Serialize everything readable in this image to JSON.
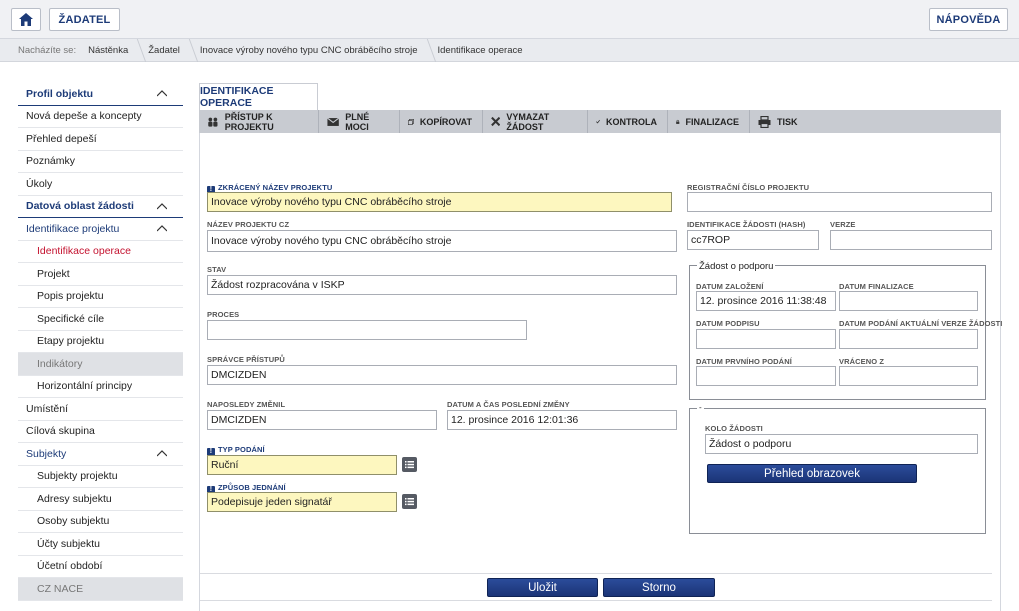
{
  "topbar": {
    "home_icon": "home-icon",
    "applicant_label": "ŽADATEL",
    "help_label": "NÁPOVĚDA"
  },
  "breadcrumb": {
    "lead": "Nacházíte se:",
    "items": [
      "Nástěnka",
      "Žadatel",
      "Inovace výroby nového typu CNC obráběcího stroje",
      "Identifikace operace"
    ]
  },
  "sidebar": {
    "items": [
      {
        "label": "Profil objektu"
      },
      {
        "label": "Nová depeše a koncepty"
      },
      {
        "label": "Přehled depeší"
      },
      {
        "label": "Poznámky"
      },
      {
        "label": "Úkoly"
      },
      {
        "label": "Datová oblast žádosti"
      },
      {
        "label": "Identifikace projektu"
      },
      {
        "label": "Identifikace operace"
      },
      {
        "label": "Projekt"
      },
      {
        "label": "Popis projektu"
      },
      {
        "label": "Specifické cíle"
      },
      {
        "label": "Etapy projektu"
      },
      {
        "label": "Indikátory"
      },
      {
        "label": "Horizontální principy"
      },
      {
        "label": "Umístění"
      },
      {
        "label": "Cílová skupina"
      },
      {
        "label": "Subjekty"
      },
      {
        "label": "Subjekty projektu"
      },
      {
        "label": "Adresy subjektu"
      },
      {
        "label": "Osoby subjektu"
      },
      {
        "label": "Účty subjektu"
      },
      {
        "label": "Účetní období"
      },
      {
        "label": "CZ NACE"
      }
    ]
  },
  "main": {
    "tab_label": "IDENTIFIKACE OPERACE",
    "toolbar": [
      {
        "label": "PŘÍSTUP K PROJEKTU",
        "icon": "people-icon"
      },
      {
        "label": "PLNÉ MOCI",
        "icon": "envelope-icon"
      },
      {
        "label": "KOPÍROVAT",
        "icon": "copy-icon"
      },
      {
        "label": "VYMAZAT ŽÁDOST",
        "icon": "delete-x-icon"
      },
      {
        "label": "KONTROLA",
        "icon": "check-icon"
      },
      {
        "label": "FINALIZACE",
        "icon": "lock-icon"
      },
      {
        "label": "TISK",
        "icon": "printer-icon"
      }
    ],
    "form": {
      "short_name_label": "ZKRÁCENÝ NÁZEV PROJEKTU",
      "short_name_value": "Inovace výroby nového typu CNC obráběcího stroje",
      "name_cz_label": "NÁZEV PROJEKTU CZ",
      "name_cz_value": "Inovace výroby nového typu CNC obráběcího stroje",
      "state_label": "STAV",
      "state_value": "Žádost rozpracována v ISKP",
      "process_label": "PROCES",
      "process_value": "",
      "access_admin_label": "SPRÁVCE PŘÍSTUPŮ",
      "access_admin_value": "DMCIZDEN",
      "last_changed_by_label": "NAPOSLEDY ZMĚNIL",
      "last_changed_by_value": "DMCIZDEN",
      "last_change_date_label": "DATUM A ČAS POSLEDNÍ ZMĚNY",
      "last_change_date_value": "12. prosince 2016 12:01:36",
      "submission_type_label": "TYP PODÁNÍ",
      "submission_type_value": "Ruční",
      "acting_method_label": "ZPŮSOB JEDNÁNÍ",
      "acting_method_value": "Podepisuje jeden signatář",
      "reg_number_label": "REGISTRAČNÍ ČÍSLO PROJEKTU",
      "reg_number_value": "",
      "hash_label": "IDENTIFIKACE ŽÁDOSTI (HASH)",
      "hash_value": "cc7ROP",
      "version_label": "VERZE",
      "version_value": ""
    },
    "support_group": {
      "title": "Žádost o podporu",
      "created_label": "DATUM ZALOŽENÍ",
      "created_value": "12. prosince 2016 11:38:48",
      "finalized_label": "DATUM FINALIZACE",
      "finalized_value": "",
      "signed_label": "DATUM PODPISU",
      "signed_value": "",
      "current_version_label": "DATUM PODÁNÍ AKTUÁLNÍ VERZE ŽÁDOSTI",
      "current_version_value": "",
      "first_submission_label": "DATUM PRVNÍHO PODÁNÍ",
      "first_submission_value": "",
      "returned_from_label": "VRÁCENO Z",
      "returned_from_value": ""
    },
    "round_group": {
      "title": "-",
      "round_label": "KOLO ŽÁDOSTI",
      "round_value": "Žádost o podporu",
      "overview_button": "Přehled obrazovek"
    },
    "actions": {
      "save": "Uložit",
      "cancel": "Storno"
    }
  },
  "colors": {
    "brand_blue": "#1d3b78",
    "active_red": "#c4122f",
    "required_yellow": "#fdf7bf"
  }
}
